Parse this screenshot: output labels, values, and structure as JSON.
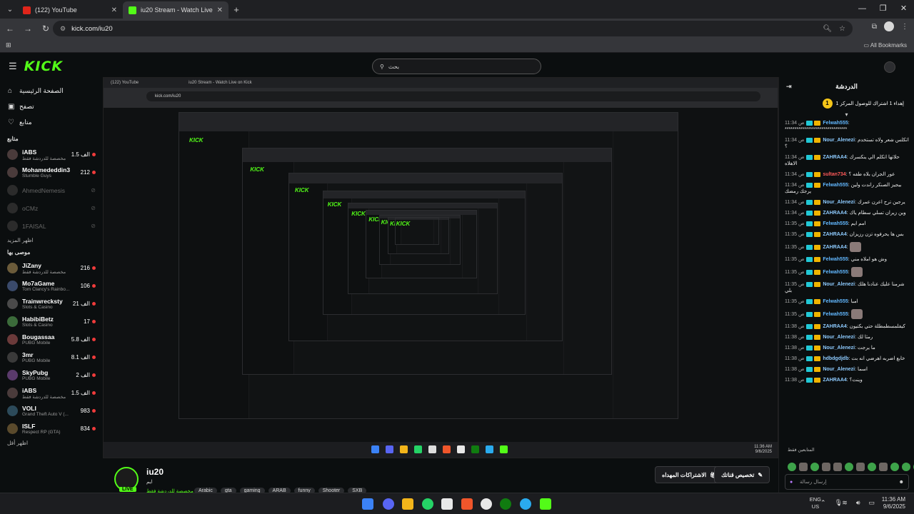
{
  "browser": {
    "tabs": [
      {
        "title": "(122) YouTube",
        "icon": "youtube-icon",
        "active": false
      },
      {
        "title": "iu20 Stream - Watch Live on Kick",
        "icon": "kick-icon",
        "active": true
      }
    ],
    "url": "kick.com/iu20",
    "all_bookmarks": "All Bookmarks"
  },
  "site": {
    "logo": "KICK",
    "search_placeholder": "بحث",
    "nav": [
      {
        "label": "الصفحة الرئيسية",
        "icon": "home-icon"
      },
      {
        "label": "تصفح",
        "icon": "browse-icon"
      },
      {
        "label": "متابع",
        "icon": "heart-icon"
      }
    ],
    "following_title": "متابع",
    "following": [
      {
        "name": "iABS",
        "sub": "مخصصة للدردشة فقط",
        "viewers": "الف 1.5",
        "online": true
      },
      {
        "name": "Mohamededdin3",
        "sub": "Stumble Guys",
        "viewers": "212",
        "online": true
      },
      {
        "name": "AhmedNemesis",
        "sub": "",
        "viewers": "",
        "online": false
      },
      {
        "name": "oCMz",
        "sub": "",
        "viewers": "",
        "online": false
      },
      {
        "name": "1FAISAL",
        "sub": "",
        "viewers": "",
        "online": false
      }
    ],
    "show_more": "اظهر المزيد",
    "recommended_title": "موصى بها",
    "recommended": [
      {
        "name": "JiZany",
        "sub": "مخصصة للدردشة فقط",
        "viewers": "216"
      },
      {
        "name": "Mo7aGame",
        "sub": "Tom Clancy's Rainbo...",
        "viewers": "106"
      },
      {
        "name": "Trainwrecksty",
        "sub": "Slots & Casino",
        "viewers": "الف 21"
      },
      {
        "name": "HabibiBetz",
        "sub": "Slots & Casino",
        "viewers": "17"
      },
      {
        "name": "Bougassaa",
        "sub": "PUBG Mobile",
        "viewers": "الف 5.8"
      },
      {
        "name": "3mr",
        "sub": "PUBG Mobile",
        "viewers": "الف 8.1"
      },
      {
        "name": "SkyPubg",
        "sub": "PUBG Mobile",
        "viewers": "الف 2"
      },
      {
        "name": "iABS",
        "sub": "مخصصة للدردشة فقط",
        "viewers": "الف 1.5"
      },
      {
        "name": "VOLI",
        "sub": "Grand Theft Auto V (...",
        "viewers": "983"
      },
      {
        "name": "ISLF",
        "sub": "Respect RP (GTA)",
        "viewers": "834"
      }
    ],
    "show_less": "اظهر أقل"
  },
  "stream": {
    "name": "iu20",
    "subtitle": "ايم",
    "category": "مخصصة للدردشة فقط",
    "live_badge": "LIVE",
    "tags": [
      "Arabic",
      "gta",
      "gaming",
      "ARAB",
      "funny",
      "Shooter",
      "SXB"
    ],
    "btn_subs": "الاشتراكات المهداه",
    "btn_customize": "تخصيص قناتك"
  },
  "chat": {
    "title": "الدردشة",
    "pinned_text": "إهداء 1 اشتراك للوصول المركز 1",
    "pinned_rank": "1",
    "messages": [
      {
        "ts": "11:34 ص",
        "user": "Felwah555",
        "text": "********************************",
        "uclass": "u1"
      },
      {
        "ts": "11:34 ص",
        "user": "Nour_Alenezi",
        "text": "اتكلس شعر ولاه تستخدم ؟",
        "uclass": "u2"
      },
      {
        "ts": "11:34 ص",
        "user": "ZAHRAA4",
        "text": "حلاتها اتكلم الي ينكسرك الاهلاه",
        "uclass": "u2"
      },
      {
        "ts": "11:34 ص",
        "user": "sultan734",
        "text": "عور الجران بلاه طفه ؟",
        "uclass": "u3"
      },
      {
        "ts": "11:34 ص",
        "user": "Felwah555",
        "text": "بيجيز الصنكر راندت ولين يرجك رمضك",
        "uclass": "u1"
      },
      {
        "ts": "11:34 ص",
        "user": "Nour_Alenezi",
        "text": "يرجين ترح اعرن عمرك",
        "uclass": "u2"
      },
      {
        "ts": "11:34 ص",
        "user": "ZAHRAA4",
        "text": "وين زيران تسلي سطام ياك",
        "uclass": "u2"
      },
      {
        "ts": "11:35 ص",
        "user": "Felwah555",
        "text": "امم ايم",
        "uclass": "u1"
      },
      {
        "ts": "11:35 ص",
        "user": "ZAHRAA4",
        "text": "بس ها يحرفوه تزن رزيزان",
        "uclass": "u2"
      },
      {
        "ts": "11:35 ص",
        "user": "ZAHRAA4",
        "text": "",
        "uclass": "u2"
      },
      {
        "ts": "11:35 ص",
        "user": "Felwah555",
        "text": "وش هو املاه مني",
        "uclass": "u1"
      },
      {
        "ts": "11:35 ص",
        "user": "Felwah555",
        "text": "",
        "uclass": "u1"
      },
      {
        "ts": "11:35 ص",
        "user": "Nour_Alenezi",
        "text": "شرمنا عليك عنادنا هلك بلي",
        "uclass": "u2"
      },
      {
        "ts": "11:35 ص",
        "user": "Felwah555",
        "text": "امبا",
        "uclass": "u1"
      },
      {
        "ts": "11:35 ص",
        "user": "Felwah555",
        "text": "",
        "uclass": "u1"
      },
      {
        "ts": "11:38 ص",
        "user": "ZAHRAA4",
        "text": "كيفلمسطمطلة حتي بكتيون",
        "uclass": "u2"
      },
      {
        "ts": "11:38 ص",
        "user": "Nour_Alenezi",
        "text": "رمثا لك",
        "uclass": "u2"
      },
      {
        "ts": "11:38 ص",
        "user": "Nour_Alenezi",
        "text": "ما يرجت",
        "uclass": "u2"
      },
      {
        "ts": "11:38 ص",
        "user": "hdbdgdjdb",
        "text": "خابع اضربه اهرضي انه بت",
        "uclass": "u2"
      },
      {
        "ts": "11:38 ص",
        "user": "Nour_Alenezi",
        "text": "اسما",
        "uclass": "u2"
      },
      {
        "ts": "11:38 ص",
        "user": "ZAHRAA4",
        "text": "وينت؟",
        "uclass": "u2"
      }
    ],
    "input_placeholder": "إرسال رسالة",
    "chatters_label": "المتابعين فقط"
  },
  "os": {
    "lang_top": "ENG",
    "lang_bottom": "US",
    "time": "11:36 AM",
    "date": "9/6/2025"
  }
}
